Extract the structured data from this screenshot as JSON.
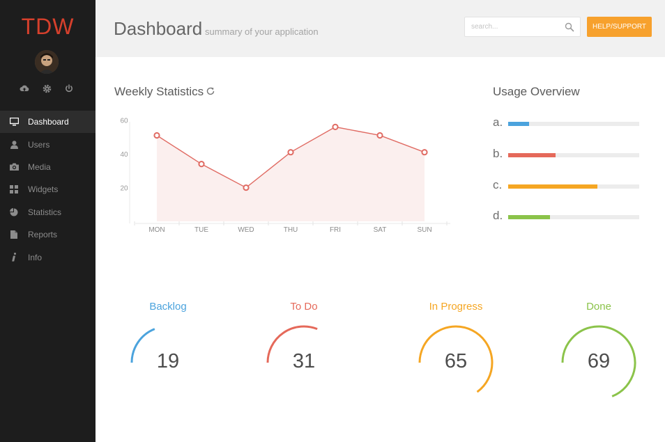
{
  "app": {
    "logo": "TDW"
  },
  "colors": {
    "accent": "#d6402c",
    "sidebar_bg": "#1d1d1d",
    "help_button": "#f7a12d",
    "chart_line": "#e06b63",
    "blue": "#4ba3dd",
    "red": "#e5695a",
    "orange": "#f5a623",
    "green": "#8bc34a"
  },
  "sidebar": {
    "utility_icons": [
      "cloud-upload-icon",
      "gear-icon",
      "power-icon"
    ],
    "items": [
      {
        "label": "Dashboard",
        "icon": "monitor-icon",
        "active": true
      },
      {
        "label": "Users",
        "icon": "user-icon",
        "active": false
      },
      {
        "label": "Media",
        "icon": "camera-icon",
        "active": false
      },
      {
        "label": "Widgets",
        "icon": "grid-icon",
        "active": false
      },
      {
        "label": "Statistics",
        "icon": "pie-chart-icon",
        "active": false
      },
      {
        "label": "Reports",
        "icon": "document-icon",
        "active": false
      },
      {
        "label": "Info",
        "icon": "info-icon",
        "active": false
      }
    ]
  },
  "header": {
    "title": "Dashboard",
    "subtitle": "summary of your application",
    "search_placeholder": "search...",
    "help_label": "HELP/SUPPORT"
  },
  "weekly": {
    "title": "Weekly Statistics"
  },
  "chart_data": {
    "type": "area",
    "categories": [
      "MON",
      "TUE",
      "WED",
      "THU",
      "FRI",
      "SAT",
      "SUN"
    ],
    "values": [
      51,
      34,
      20,
      41,
      56,
      51,
      41
    ],
    "yticks": [
      20,
      40,
      60
    ],
    "ylim": [
      0,
      64
    ],
    "grid": false
  },
  "usage": {
    "title": "Usage Overview",
    "rows": [
      {
        "letter": "a.",
        "value": 0.16,
        "color": "#4ba3dd"
      },
      {
        "letter": "b.",
        "value": 0.36,
        "color": "#e5695a"
      },
      {
        "letter": "c.",
        "value": 0.68,
        "color": "#f5a623"
      },
      {
        "letter": "d.",
        "value": 0.32,
        "color": "#8bc34a"
      }
    ]
  },
  "gauges": [
    {
      "label": "Backlog",
      "value": "19",
      "fraction": 0.19,
      "color": "#4ba3dd"
    },
    {
      "label": "To Do",
      "value": "31",
      "fraction": 0.31,
      "color": "#e5695a"
    },
    {
      "label": "In Progress",
      "value": "65",
      "fraction": 0.65,
      "color": "#f5a623"
    },
    {
      "label": "Done",
      "value": "69",
      "fraction": 0.69,
      "color": "#8bc34a"
    }
  ]
}
